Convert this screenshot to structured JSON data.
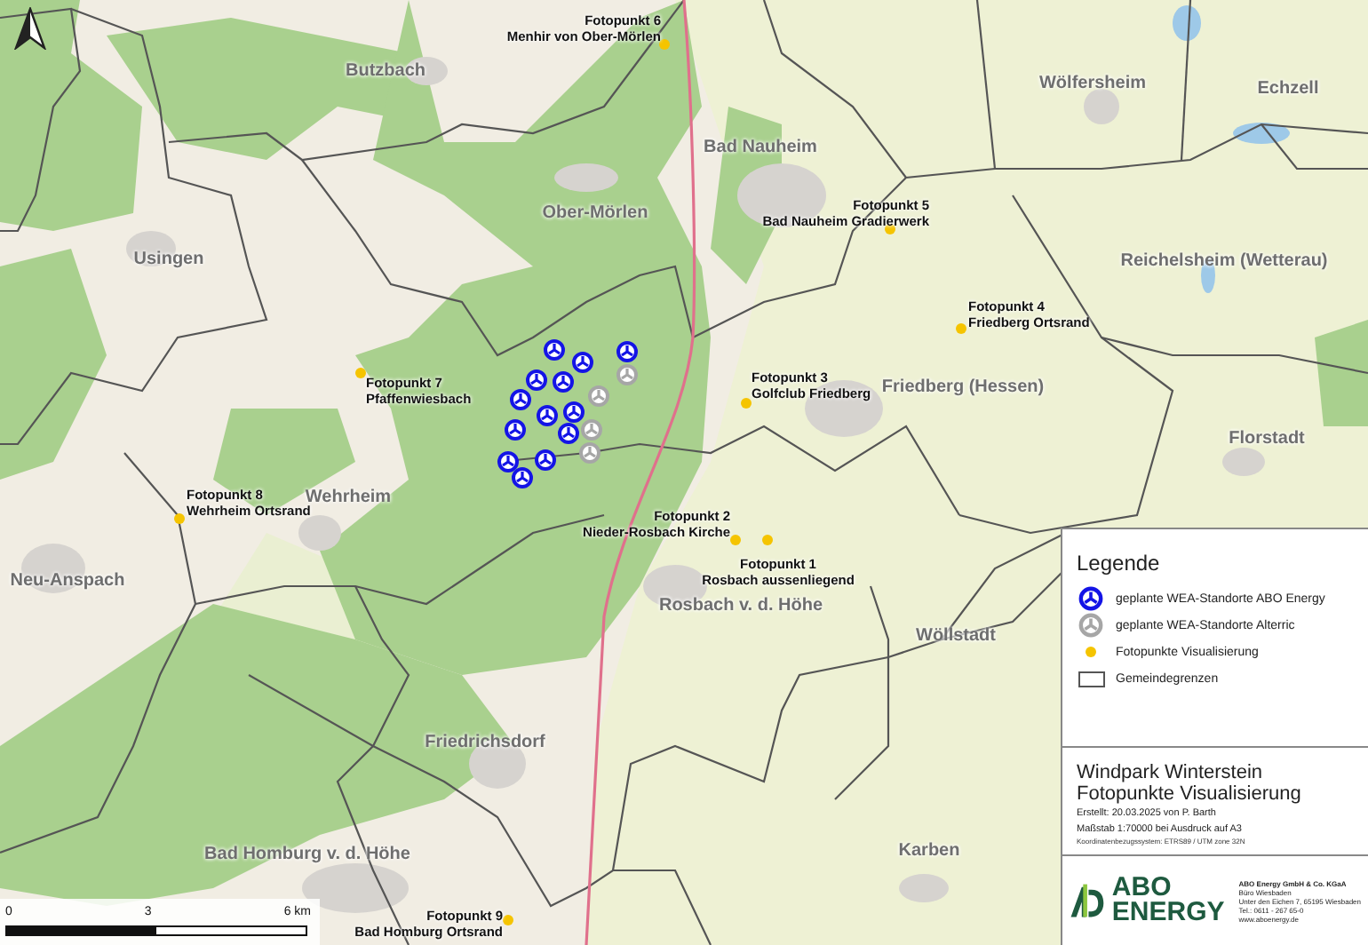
{
  "map": {
    "place_names": [
      "Butzbach",
      "Ober-Mörlen",
      "Usingen",
      "Bad Nauheim",
      "Wölfersheim",
      "Echzell",
      "Reichelsheim (Wetterau)",
      "Friedberg (Hessen)",
      "Florstadt",
      "Neu-Anspach",
      "Wehrheim",
      "Rosbach v. d. Höhe",
      "Wöllstadt",
      "Friedrichsdorf",
      "Bad Homburg v. d. Höhe",
      "Karben"
    ],
    "photo_points": [
      {
        "title": "Fotopunkt 1",
        "subtitle": "Rosbach aussenliegend"
      },
      {
        "title": "Fotopunkt 2",
        "subtitle": "Nieder-Rosbach Kirche"
      },
      {
        "title": "Fotopunkt 3",
        "subtitle": "Golfclub Friedberg"
      },
      {
        "title": "Fotopunkt 4",
        "subtitle": "Friedberg Ortsrand"
      },
      {
        "title": "Fotopunkt 5",
        "subtitle": "Bad Nauheim Gradierwerk"
      },
      {
        "title": "Fotopunkt 6",
        "subtitle": "Menhir von Ober-Mörlen"
      },
      {
        "title": "Fotopunkt 7",
        "subtitle": "Pfaffenwiesbach"
      },
      {
        "title": "Fotopunkt 8",
        "subtitle": "Wehrheim Ortsrand"
      },
      {
        "title": "Fotopunkt 9",
        "subtitle": "Bad Homburg Ortsrand"
      }
    ],
    "turbines": [
      {
        "kind": "abo"
      },
      {
        "kind": "abo"
      },
      {
        "kind": "abo"
      },
      {
        "kind": "abo"
      },
      {
        "kind": "abo"
      },
      {
        "kind": "abo"
      },
      {
        "kind": "abo"
      },
      {
        "kind": "abo"
      },
      {
        "kind": "abo"
      },
      {
        "kind": "abo"
      },
      {
        "kind": "abo"
      },
      {
        "kind": "abo"
      },
      {
        "kind": "abo"
      },
      {
        "kind": "alterric"
      },
      {
        "kind": "alterric"
      },
      {
        "kind": "alterric"
      },
      {
        "kind": "alterric"
      }
    ],
    "scale_bar": {
      "labels": [
        "0",
        "3",
        "6 km"
      ]
    }
  },
  "legend": {
    "title": "Legende",
    "items": [
      {
        "kind": "abo",
        "label": "geplante WEA-Standorte ABO Energy"
      },
      {
        "kind": "alterric",
        "label": "geplante WEA-Standorte Alterric"
      },
      {
        "kind": "photo",
        "label": "Fotopunkte Visualisierung"
      },
      {
        "kind": "boundary",
        "label": "Gemeindegrenzen"
      }
    ]
  },
  "title_block": {
    "title": "Windpark Winterstein",
    "subtitle": "Fotopunkte Visualisierung",
    "lines": [
      "Erstellt: 20.03.2025 von P. Barth",
      "Maßstab 1:70000  bei Ausdruck auf A3"
    ],
    "footnote": "Koordinatenbezugssystem: ETRS89 / UTM zone 32N"
  },
  "company": {
    "logo_lines": [
      "ABO",
      "ENERGY"
    ],
    "address": [
      "ABO Energy GmbH & Co. KGaA",
      "Büro Wiesbaden",
      "Unter den Eichen 7, 65195 Wiesbaden",
      "Tel.: 0611 - 267 65-0",
      "www.aboenergy.de"
    ]
  }
}
